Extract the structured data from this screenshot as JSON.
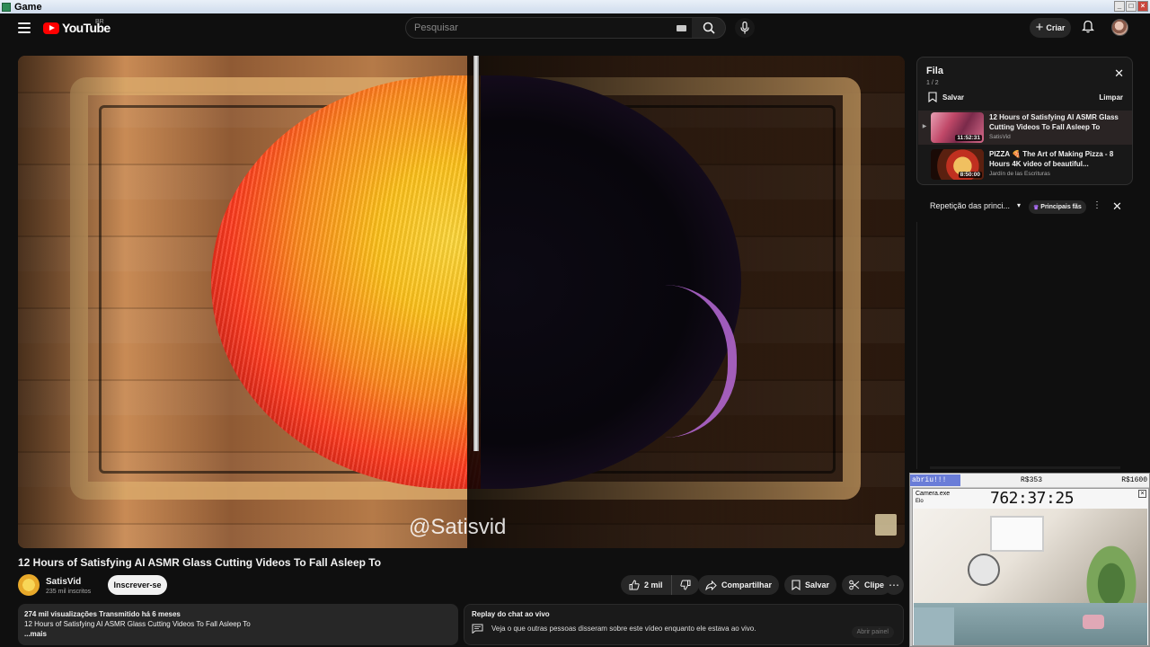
{
  "window": {
    "title": "Game"
  },
  "header": {
    "logo_word": "YouTube",
    "country_code": "BR",
    "search_placeholder": "Pesquisar",
    "create_label": "Criar"
  },
  "video": {
    "watermark": "@Satisvid",
    "title": "12 Hours of Satisfying AI ASMR Glass Cutting Videos To Fall Asleep To",
    "channel_name": "SatisVid",
    "channel_subs": "235 mil inscritos",
    "subscribe_label": "Inscrever-se",
    "likes": "2 mil",
    "share_label": "Compartilhar",
    "save_label": "Salvar",
    "clip_label": "Clipe",
    "more_label": "⋯"
  },
  "description": {
    "meta": "274 mil visualizações  Transmitido há 6 meses",
    "text": "12 Hours of Satisfying AI ASMR Glass Cutting Videos To Fall Asleep To",
    "more": "...mais"
  },
  "chat_replay": {
    "heading": "Replay do chat ao vivo",
    "text": "Veja o que outras pessoas disseram sobre este vídeo enquanto ele estava ao vivo.",
    "open_button": "Abrir painel"
  },
  "queue": {
    "title": "Fila",
    "count": "1 / 2",
    "save_label": "Salvar",
    "clear_label": "Limpar",
    "items": [
      {
        "title": "12 Hours of Satisfying AI ASMR Glass Cutting Videos To Fall Asleep To",
        "channel": "SatisVid",
        "duration": "11:52:31",
        "marker": "▶"
      },
      {
        "title": "PIZZA 🍕 The Art of Making Pizza - 8 Hours 4K video of beautiful...",
        "channel": "Jardín de las Escrituras",
        "duration": "8:50:00",
        "marker": ""
      }
    ]
  },
  "chat": {
    "mode_label": "Repetição das princi...",
    "top_fans_label": "Principais fãs"
  },
  "overlay": {
    "bar_left": "abriu!!!",
    "bar_mid": "R$353",
    "bar_right": "R$1600",
    "window_title": "Camera.exe",
    "menu": "Elo",
    "timer": "762:37:25"
  },
  "colors": {
    "background": "#0f0f0f",
    "youtube_red": "#ff0000",
    "subscribe_bg": "#f1f1f1",
    "pill_bg": "#272727"
  }
}
